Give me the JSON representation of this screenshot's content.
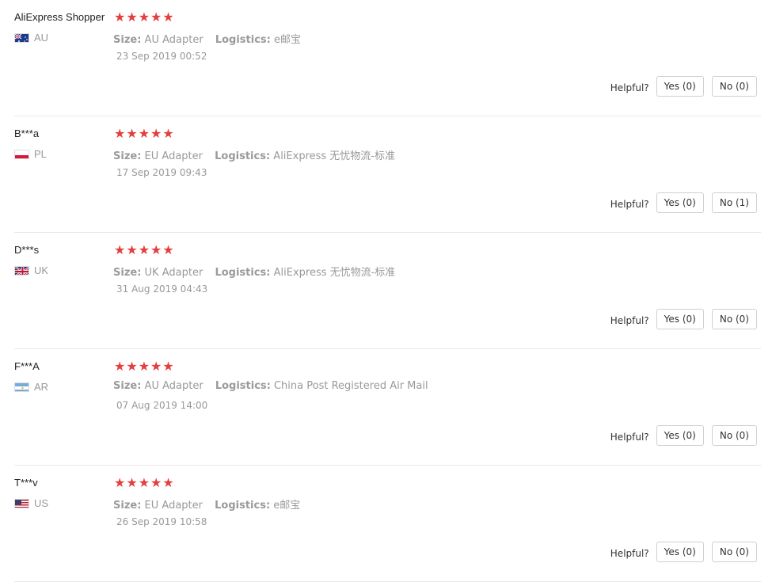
{
  "labels": {
    "size": "Size:",
    "logistics": "Logistics:",
    "helpful": "Helpful?"
  },
  "reviews": [
    {
      "user": "AliExpress Shopper",
      "country": "AU",
      "flag": "au-flag-icon",
      "stars": 5,
      "size": "AU Adapter",
      "logistics": "e邮宝",
      "date": "23 Sep 2019 00:52",
      "yes": "Yes (0)",
      "no": "No (0)"
    },
    {
      "user": "B***a",
      "country": "PL",
      "flag": "pl-flag-icon",
      "stars": 5,
      "size": "EU Adapter",
      "logistics": "AliExpress 无忧物流-标准",
      "date": "17 Sep 2019 09:43",
      "yes": "Yes (0)",
      "no": "No (1)"
    },
    {
      "user": "D***s",
      "country": "UK",
      "flag": "uk-flag-icon",
      "stars": 5,
      "size": "UK Adapter",
      "logistics": "AliExpress 无忧物流-标准",
      "date": "31 Aug 2019 04:43",
      "yes": "Yes (0)",
      "no": "No (0)"
    },
    {
      "user": "F***A",
      "country": "AR",
      "flag": "ar-flag-icon",
      "stars": 5,
      "size": "AU Adapter",
      "logistics": "China Post Registered Air Mail",
      "date": "07 Aug 2019 14:00",
      "yes": "Yes (0)",
      "no": "No (0)"
    },
    {
      "user": "T***v",
      "country": "US",
      "flag": "us-flag-icon",
      "stars": 5,
      "size": "EU Adapter",
      "logistics": "e邮宝",
      "date": "26 Sep 2019 10:58",
      "yes": "Yes (0)",
      "no": "No (0)"
    }
  ],
  "colors": {
    "star": "#e53e3e",
    "muted": "#999999",
    "divider": "#e8e8e8"
  }
}
